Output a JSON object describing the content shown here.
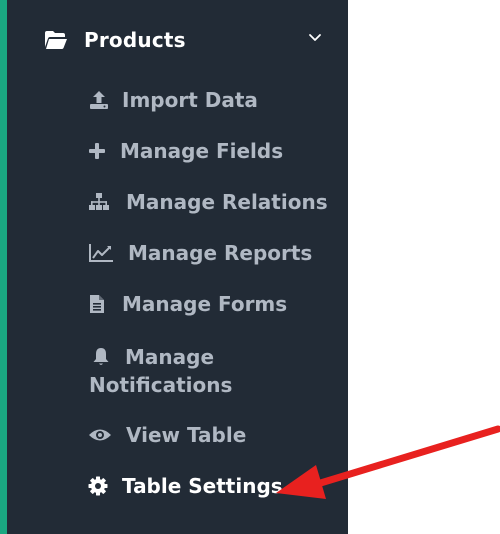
{
  "sidebar": {
    "section": {
      "title": "Products",
      "icon": "folder-open-icon",
      "expanded": true
    },
    "items": [
      {
        "label": "Import Data",
        "icon": "upload-icon"
      },
      {
        "label": "Manage Fields",
        "icon": "plus-icon"
      },
      {
        "label": "Manage Relations",
        "icon": "sitemap-icon"
      },
      {
        "label": "Manage Reports",
        "icon": "line-chart-icon"
      },
      {
        "label": "Manage Forms",
        "icon": "file-text-icon"
      },
      {
        "label_line1": "Manage",
        "label_line2": "Notifications",
        "icon": "bell-icon"
      },
      {
        "label": "View Table",
        "icon": "eye-icon"
      },
      {
        "label": "Table Settings",
        "icon": "gear-icon",
        "active": true
      }
    ]
  },
  "colors": {
    "sidebar_bg": "#222b36",
    "accent": "#1aa881",
    "item_text": "#b0b8c3",
    "active_text": "#ffffff",
    "arrow": "#e8211f"
  }
}
